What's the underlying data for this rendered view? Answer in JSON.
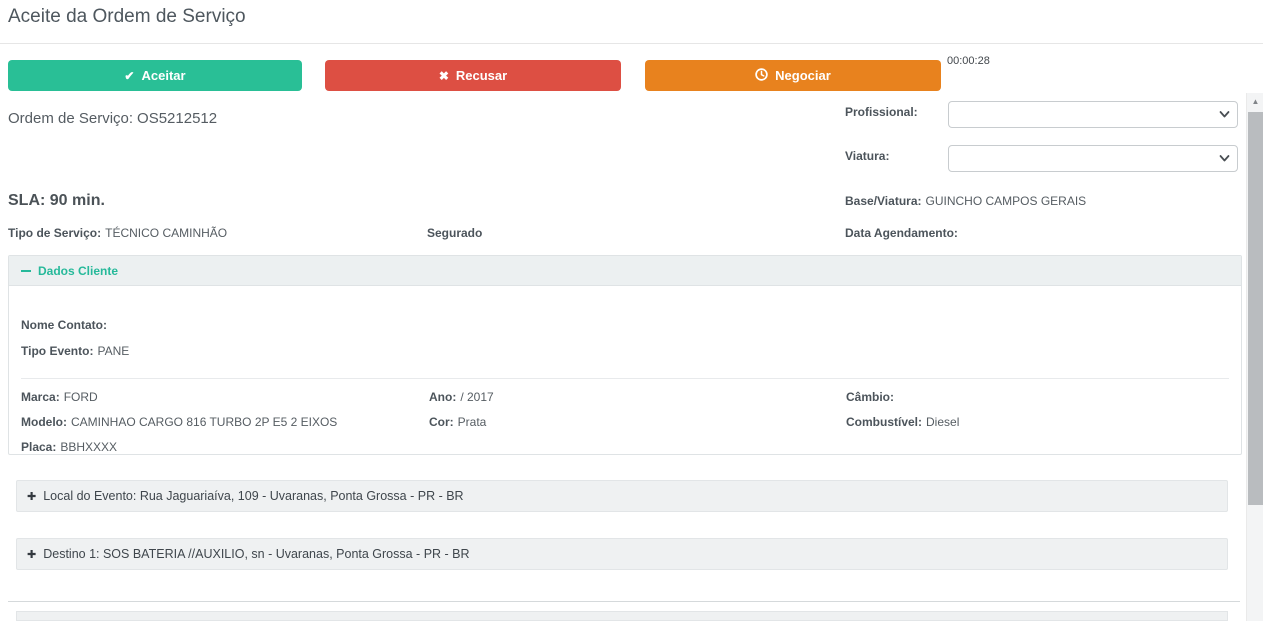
{
  "header": {
    "title": "Aceite da Ordem de Serviço"
  },
  "toolbar": {
    "accept_label": "Aceitar",
    "refuse_label": "Recusar",
    "negotiate_label": "Negociar",
    "timer": "00:00:28"
  },
  "order": {
    "label": "Ordem de Serviço:",
    "value": "OS5212512"
  },
  "assignment": {
    "profissional_label": "Profissional:",
    "profissional_value": "",
    "viatura_label": "Viatura:",
    "viatura_value": "",
    "base_viatura_label": "Base/Viatura:",
    "base_viatura_value": "GUINCHO CAMPOS GERAIS",
    "data_agendamento_label": "Data Agendamento:",
    "data_agendamento_value": ""
  },
  "service": {
    "sla": "SLA: 90 min.",
    "tipo_servico_label": "Tipo de Serviço:",
    "tipo_servico_value": "TÉCNICO CAMINHÃO",
    "segurado_label": "Segurado"
  },
  "dados_cliente": {
    "title": "Dados Cliente",
    "nome_contato": {
      "label": "Nome Contato:",
      "value": ""
    },
    "tipo_evento": {
      "label": "Tipo Evento:",
      "value": "PANE"
    },
    "marca": {
      "label": "Marca:",
      "value": "FORD"
    },
    "modelo": {
      "label": "Modelo:",
      "value": "CAMINHAO CARGO 816 TURBO 2P E5 2 EIXOS"
    },
    "placa": {
      "label": "Placa:",
      "value": "BBHXXXX"
    },
    "ano": {
      "label": "Ano:",
      "value": "/ 2017"
    },
    "cor": {
      "label": "Cor:",
      "value": "Prata"
    },
    "cambio": {
      "label": "Câmbio:",
      "value": ""
    },
    "combustivel": {
      "label": "Combustível:",
      "value": "Diesel"
    }
  },
  "sections": {
    "local_evento": "Local do Evento: Rua Jaguariaíva, 109 - Uvaranas, Ponta Grossa - PR - BR",
    "destino1": "Destino 1: SOS BATERIA //AUXILIO, sn - Uvaranas, Ponta Grossa - PR - BR"
  },
  "icons": {
    "check_icon": "✔",
    "x_icon": "✖",
    "clock_icon": "svg-clock",
    "minus_icon": "css-bar",
    "plus_icon": "✚",
    "chevron_down_icon": "svg-chevron",
    "scroll_up_icon": "▲"
  },
  "colors": {
    "accept_green": "#29bf96",
    "refuse_red": "#dd4f43",
    "negotiate_orange": "#e8821e",
    "section_teal": "#26b99a"
  }
}
